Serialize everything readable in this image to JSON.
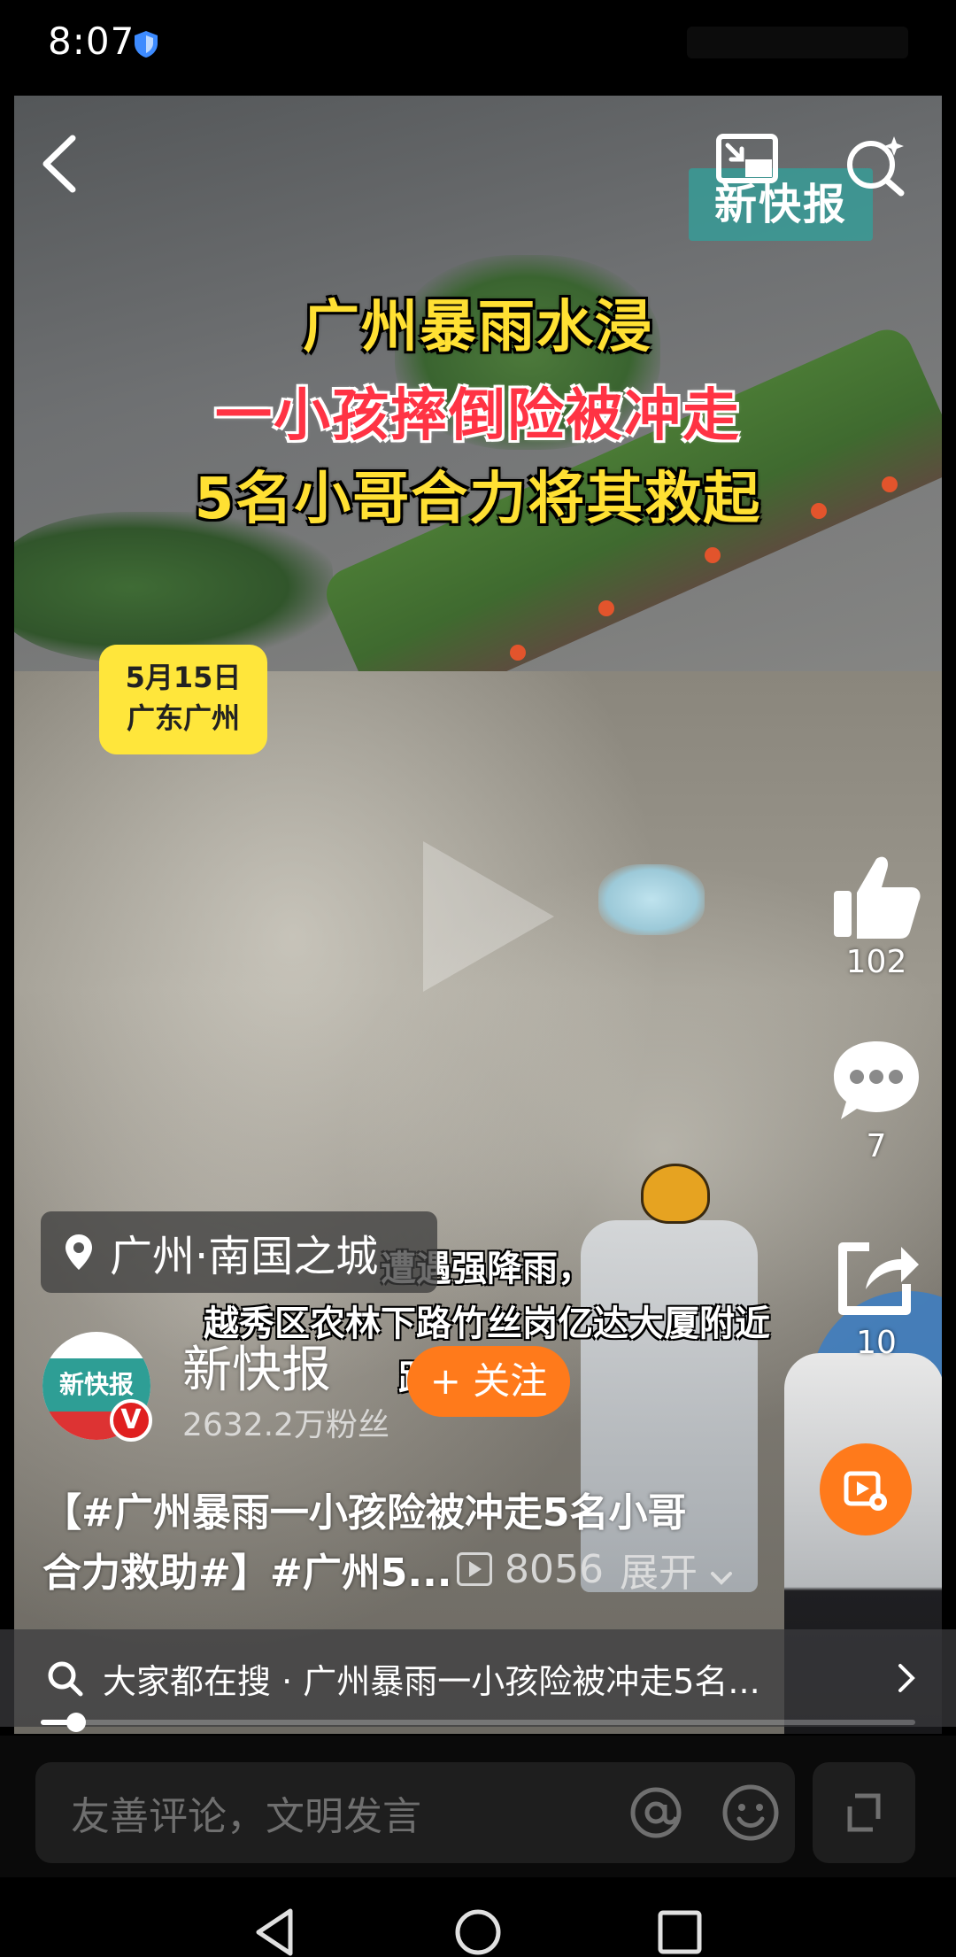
{
  "status_bar": {
    "time": "8:07"
  },
  "video": {
    "watermark": "新快报",
    "headline": [
      "广州暴雨水浸",
      "一小孩摔倒险被冲走",
      "5名小哥合力将其救起"
    ],
    "date_badge": [
      "5月15日",
      "广东广州"
    ],
    "subtitles": [
      "遭遇强降雨，",
      "越秀区农林下路竹丝岗亿达大厦附近",
      "路面水浸。"
    ]
  },
  "rail": {
    "likes": "102",
    "comments": "7",
    "shares": "10"
  },
  "location": {
    "label": "广州·南国之城"
  },
  "author": {
    "name": "新快报",
    "avatar_text": "新快报",
    "verified_mark": "V",
    "followers": "2632.2万粉丝",
    "follow_label": "+ 关注"
  },
  "description": {
    "line1": "【#广州暴雨一小孩险被冲走5名小哥",
    "line2": "合力救助#】#广州5...",
    "views": "8056",
    "expand_label": "展开"
  },
  "search_strip": {
    "text": "大家都在搜 · 广州暴雨一小孩险被冲走5名..."
  },
  "progress": {
    "fraction": 0.04
  },
  "comment_bar": {
    "placeholder": "友善评论，文明发言"
  },
  "colors": {
    "accent": "#ff7a1b",
    "badge": "#ffe63b",
    "headline_yellow": "#ffe033",
    "headline_red": "#ff3344"
  }
}
